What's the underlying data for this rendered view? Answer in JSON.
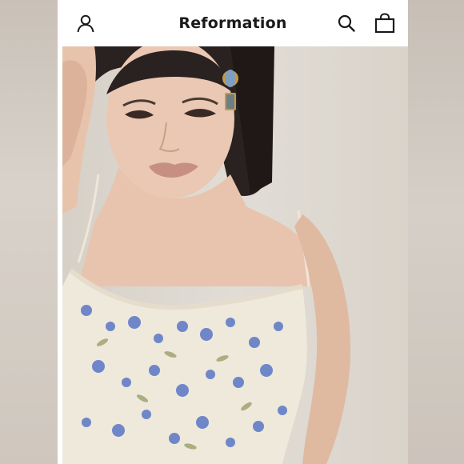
{
  "header": {
    "brand": "Reformation",
    "icons": {
      "account": "user-icon",
      "search": "search-icon",
      "bag": "shopping-bag-icon"
    }
  },
  "colors": {
    "header_bg": "#ffffff",
    "brand_text": "#1a1a1a",
    "dress": "#efe9dc",
    "flowers": "#6f86c9"
  }
}
